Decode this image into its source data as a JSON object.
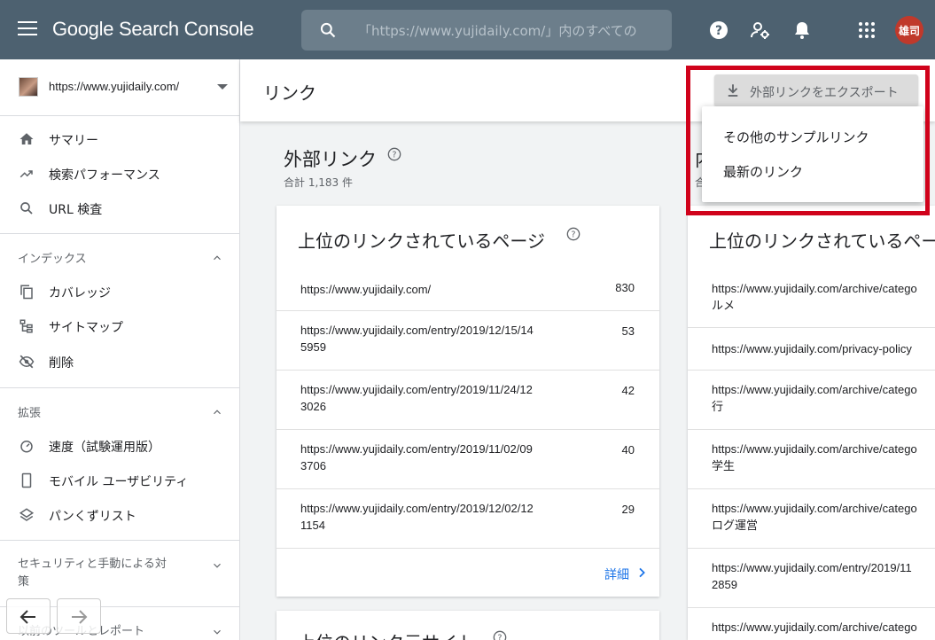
{
  "app": {
    "brand": "Google Search Console"
  },
  "search": {
    "placeholder": "「https://www.yujidaily.com/」内のすべての"
  },
  "user": {
    "avatar_text": "雄司"
  },
  "property": {
    "url": "https://www.yujidaily.com/"
  },
  "sidebar": {
    "top_items": [
      {
        "label": "サマリー",
        "icon": "home-icon"
      },
      {
        "label": "検索パフォーマンス",
        "icon": "trending-up-icon"
      },
      {
        "label": "URL 検査",
        "icon": "search-icon"
      }
    ],
    "index_section": {
      "label": "インデックス",
      "items": [
        {
          "label": "カバレッジ",
          "icon": "copy-icon"
        },
        {
          "label": "サイトマップ",
          "icon": "sitemap-icon"
        },
        {
          "label": "削除",
          "icon": "visibility-off-icon"
        }
      ]
    },
    "enhance_section": {
      "label": "拡張",
      "items": [
        {
          "label": "速度（試験運用版）",
          "icon": "speed-icon"
        },
        {
          "label": "モバイル ユーザビリティ",
          "icon": "smartphone-icon"
        },
        {
          "label": "パンくずリスト",
          "icon": "layers-icon"
        }
      ]
    },
    "security_section": {
      "label": "セキュリティと手動による対策"
    },
    "legacy_section": {
      "label": "以前のツールとレポート"
    }
  },
  "page": {
    "title": "リンク"
  },
  "export": {
    "button_label": "外部リンクをエクスポート",
    "menu": [
      "その他のサンプルリンク",
      "最新のリンク"
    ]
  },
  "external": {
    "title": "外部リンク",
    "subtitle": "合計 1,183 件",
    "top_pages": {
      "title": "上位のリンクされているページ",
      "rows": [
        {
          "url_line1": "https://www.yujidaily.com/",
          "url_line2": "",
          "count": "830"
        },
        {
          "url_line1": "https://www.yujidaily.com/entry/2019/12/15/14",
          "url_line2": "5959",
          "count": "53"
        },
        {
          "url_line1": "https://www.yujidaily.com/entry/2019/11/24/12",
          "url_line2": "3026",
          "count": "42"
        },
        {
          "url_line1": "https://www.yujidaily.com/entry/2019/11/02/09",
          "url_line2": "3706",
          "count": "40"
        },
        {
          "url_line1": "https://www.yujidaily.com/entry/2019/12/02/12",
          "url_line2": "1154",
          "count": "29"
        }
      ],
      "details_label": "詳細"
    },
    "top_sites": {
      "title": "上位のリンク元サイト"
    }
  },
  "internal": {
    "title_partial": "内",
    "subtitle_partial": "合",
    "top_pages": {
      "title": "上位のリンクされているペー",
      "rows": [
        {
          "url_line1": "https://www.yujidaily.com/archive/catego",
          "url_line2": "ルメ"
        },
        {
          "url_line1": "https://www.yujidaily.com/privacy-policy",
          "url_line2": ""
        },
        {
          "url_line1": "https://www.yujidaily.com/archive/catego",
          "url_line2": "行"
        },
        {
          "url_line1": "https://www.yujidaily.com/archive/catego",
          "url_line2": "学生"
        },
        {
          "url_line1": "https://www.yujidaily.com/archive/catego",
          "url_line2": "ログ運営"
        },
        {
          "url_line1": "https://www.yujidaily.com/entry/2019/11",
          "url_line2": "2859"
        },
        {
          "url_line1": "https://www.yujidaily.com/archive/catego",
          "url_line2": ""
        }
      ]
    }
  },
  "colors": {
    "appbar": "#4d6170",
    "highlight": "#d0021b",
    "link": "#1a73e8"
  }
}
